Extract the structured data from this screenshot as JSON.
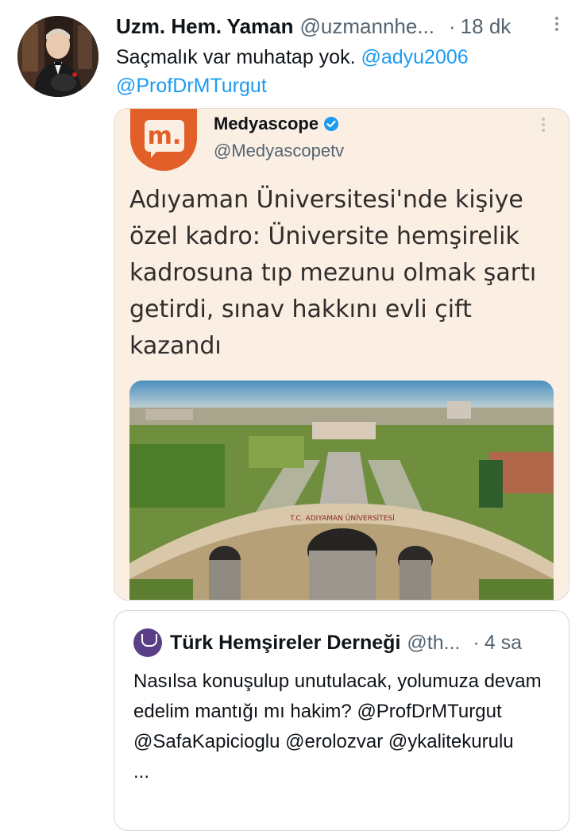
{
  "tweet": {
    "author_name": "Uzm. Hem. Yaman",
    "author_handle": "@uzmannhe...",
    "dot": "·",
    "time": "18 dk",
    "text": "Saçmalık var muhatap yok. ",
    "mention1": "@adyu2006",
    "mention2": "@ProfDrMTurgut"
  },
  "card": {
    "logo_letter": "m.",
    "name": "Medyascope",
    "handle": "@Medyascopetv",
    "headline": "Adıyaman Üniversitesi'nde kişiye özel kadro: Üniversite hemşirelik kadrosuna tıp mezunu olmak şartı getirdi, sınav hakkını evli çift kazandı",
    "photo_sign": "T.C. ADIYAMAN ÜNİVERSİTESİ"
  },
  "quote": {
    "author_name": "Türk Hemşireler Derneği",
    "author_handle": "@th",
    "handle_ellipsis": "...",
    "dot": "·",
    "time": "4 sa",
    "text": "Nasılsa konuşulup unutulacak, yolumuza devam edelim mantığı mı hakim? @ProfDrMTurgut @SafaKapicioglu @erolozvar @ykalitekurulu",
    "trailing": "..."
  },
  "colors": {
    "link": "#1d9bf0",
    "medyascope_orange": "#e35f2a",
    "card_bg": "#fbeee3",
    "verified": "#1d9bf0"
  },
  "icons": {
    "more": "more-vertical-icon",
    "verified": "verified-badge-icon"
  }
}
